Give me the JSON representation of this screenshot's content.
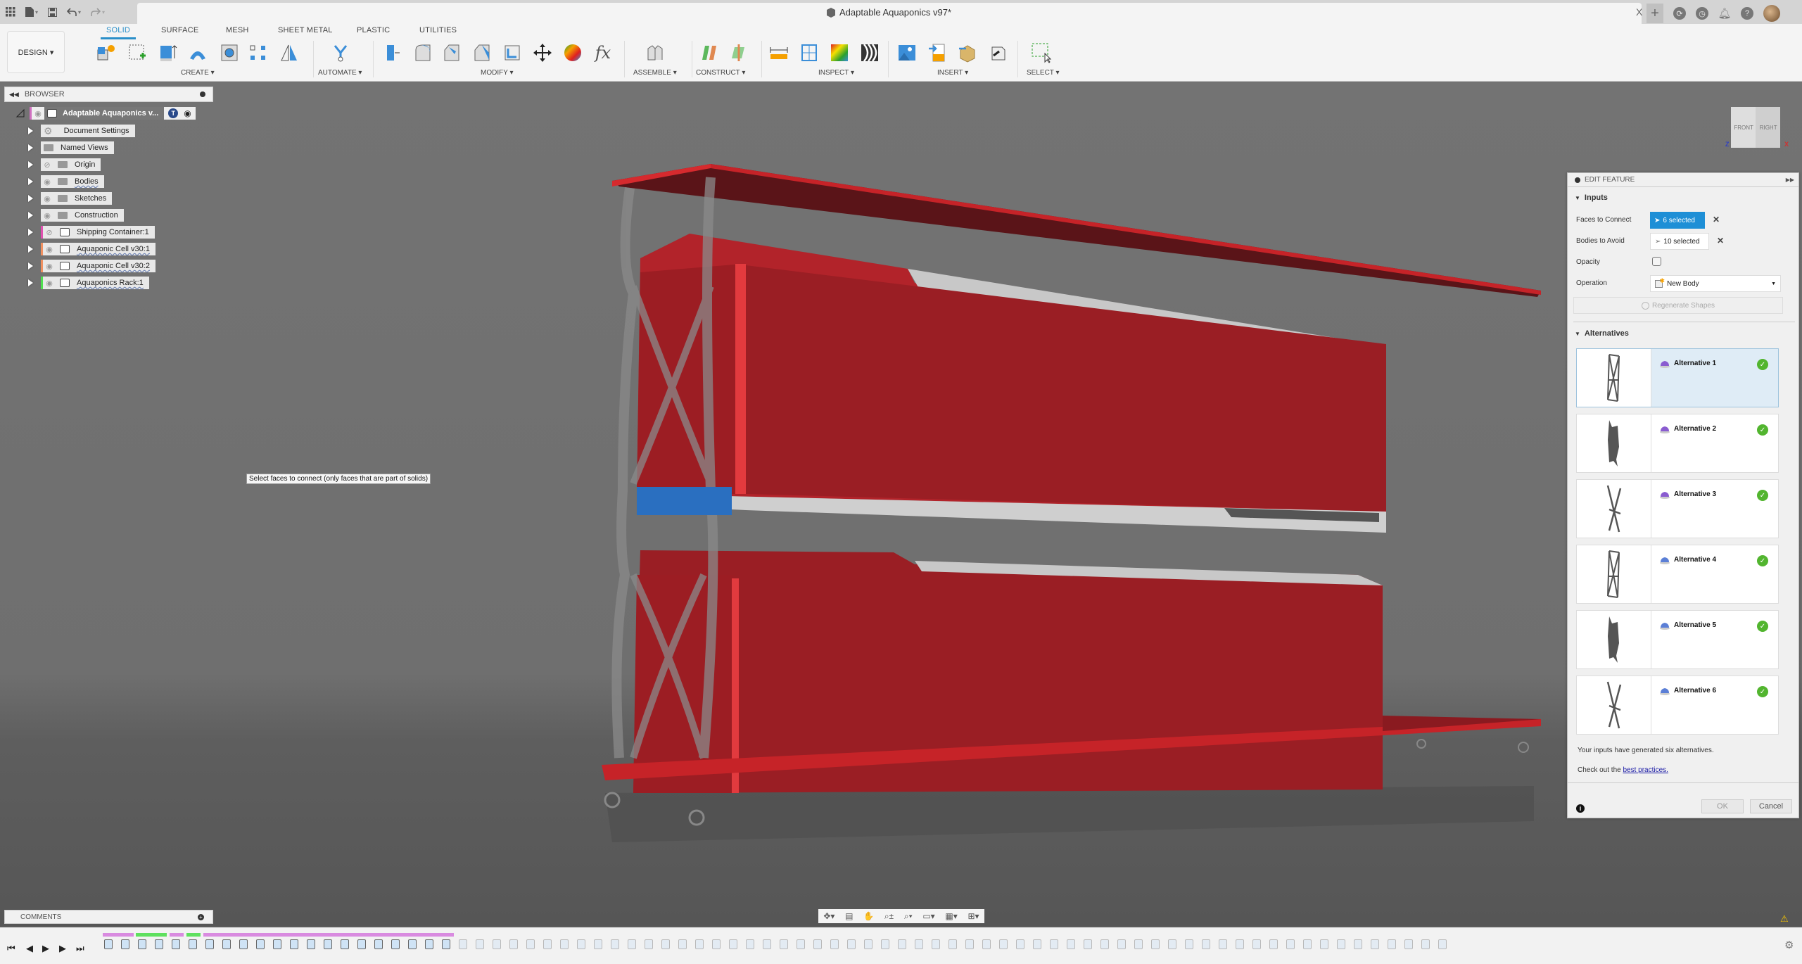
{
  "app": {
    "document_title": "Adaptable Aquaponics v97*",
    "quick_access": {
      "grid_icon": "apps-grid-icon",
      "file_icon": "file-icon",
      "save_icon": "save-icon",
      "undo_icon": "undo-icon",
      "redo_icon": "redo-icon"
    },
    "right_icons": [
      "new-tab-icon",
      "job-status-icon",
      "history-clock-icon",
      "notifications-bell-icon",
      "help-icon",
      "user-avatar"
    ],
    "close_label": "X",
    "plus_label": "+"
  },
  "ribbon": {
    "workspace": "DESIGN ▾",
    "tabs": [
      {
        "label": "SOLID",
        "active": true
      },
      {
        "label": "SURFACE",
        "active": false
      },
      {
        "label": "MESH",
        "active": false
      },
      {
        "label": "SHEET METAL",
        "active": false
      },
      {
        "label": "PLASTIC",
        "active": false
      },
      {
        "label": "UTILITIES",
        "active": false
      }
    ],
    "groups": [
      {
        "label": "CREATE ▾",
        "tools": [
          "new-component-icon",
          "create-sketch-icon",
          "extrude-icon",
          "revolve-icon",
          "hole-icon",
          "pattern-icon",
          "mirror-icon"
        ]
      },
      {
        "label": "AUTOMATE ▾",
        "tools": [
          "automate-icon"
        ]
      },
      {
        "label": "MODIFY ▾",
        "tools": [
          "press-pull-icon",
          "fillet-icon",
          "chamfer-icon",
          "shell-icon",
          "combine-icon",
          "move-icon",
          "appearance-icon",
          "parameters-fx-icon"
        ]
      },
      {
        "label": "ASSEMBLE ▾",
        "tools": [
          "joint-icon"
        ]
      },
      {
        "label": "CONSTRUCT ▾",
        "tools": [
          "offset-plane-icon",
          "midplane-icon"
        ]
      },
      {
        "label": "INSPECT ▾",
        "tools": [
          "measure-icon",
          "section-analysis-icon",
          "curvature-map-icon",
          "zebra-icon"
        ]
      },
      {
        "label": "INSERT ▾",
        "tools": [
          "decal-icon",
          "insert-svg-icon",
          "insert-mesh-icon",
          "insert-derive-icon"
        ]
      },
      {
        "label": "SELECT ▾",
        "tools": [
          "window-select-icon"
        ]
      }
    ]
  },
  "browser": {
    "title": "BROWSER",
    "root": {
      "label": "Adaptable Aquaponics v...",
      "badge": "T"
    },
    "items": [
      {
        "label": "Document Settings",
        "icon": "gear-icon",
        "visible": null,
        "tag": null,
        "wavy": false
      },
      {
        "label": "Named Views",
        "icon": "folder-icon",
        "visible": null,
        "tag": null,
        "wavy": false
      },
      {
        "label": "Origin",
        "icon": "folder-icon",
        "visible": false,
        "tag": null,
        "wavy": false
      },
      {
        "label": "Bodies",
        "icon": "folder-icon",
        "visible": true,
        "tag": null,
        "wavy": true
      },
      {
        "label": "Sketches",
        "icon": "folder-icon",
        "visible": true,
        "tag": null,
        "wavy": false
      },
      {
        "label": "Construction",
        "icon": "folder-icon",
        "visible": true,
        "tag": null,
        "wavy": false
      },
      {
        "label": "Shipping Container:1",
        "icon": "component-icon",
        "visible": false,
        "tag": "#e050b0",
        "wavy": false
      },
      {
        "label": "Aquaponic Cell v30:1",
        "icon": "component-icon",
        "visible": true,
        "tag": "#f09060",
        "wavy": true
      },
      {
        "label": "Aquaponic Cell v30:2",
        "icon": "component-icon",
        "visible": true,
        "tag": "#f09060",
        "wavy": true
      },
      {
        "label": "Aquaponics Rack:1",
        "icon": "component-icon",
        "visible": true,
        "tag": "#50e050",
        "wavy": true
      }
    ]
  },
  "viewport": {
    "tooltip": "Select faces to connect (only faces that are part of solids)",
    "viewcube": {
      "front": "FRONT",
      "right": "RIGHT",
      "axis_z": "Z",
      "axis_x": "X"
    }
  },
  "edit_feature": {
    "title": "EDIT FEATURE",
    "inputs_header": "Inputs",
    "faces_to_connect": {
      "label": "Faces to Connect",
      "value": "6 selected"
    },
    "bodies_to_avoid": {
      "label": "Bodies to Avoid",
      "value": "10 selected"
    },
    "opacity": {
      "label": "Opacity",
      "checked": false
    },
    "operation": {
      "label": "Operation",
      "value": "New Body"
    },
    "regenerate": "Regenerate Shapes",
    "alternatives_header": "Alternatives",
    "alternatives": [
      {
        "name": "Alternative 1",
        "selected": true,
        "status": "ok",
        "shape": "lattice",
        "icon_color": "#8a5cd0"
      },
      {
        "name": "Alternative 2",
        "selected": false,
        "status": "ok",
        "shape": "solid",
        "icon_color": "#8a5cd0"
      },
      {
        "name": "Alternative 3",
        "selected": false,
        "status": "ok",
        "shape": "cross",
        "icon_color": "#8a5cd0"
      },
      {
        "name": "Alternative 4",
        "selected": false,
        "status": "ok",
        "shape": "lattice",
        "icon_color": "#5b7fd6"
      },
      {
        "name": "Alternative 5",
        "selected": false,
        "status": "ok",
        "shape": "solid",
        "icon_color": "#5b7fd6"
      },
      {
        "name": "Alternative 6",
        "selected": false,
        "status": "ok",
        "shape": "cross",
        "icon_color": "#5b7fd6"
      }
    ],
    "summary": "Your inputs have generated six alternatives.",
    "link_prefix": "Check out the ",
    "link_text": "best practices.",
    "ok": "OK",
    "cancel": "Cancel"
  },
  "bottom": {
    "comments_title": "COMMENTS",
    "nav_tools": [
      "orbit-icon",
      "look-at-icon",
      "pan-hand-icon",
      "zoom-icon",
      "fit-zoom-icon",
      "display-settings-icon",
      "grid-settings-icon",
      "viewports-icon"
    ],
    "timeline_controls": [
      "skip-start-icon",
      "step-back-icon",
      "play-icon",
      "step-forward-icon",
      "skip-end-icon"
    ]
  },
  "colors": {
    "accent": "#2a8fc9",
    "selected_input": "#1e8fd6",
    "model_red": "#9a1e24",
    "model_red_bright": "#d6262b",
    "success_green": "#52b52f",
    "link": "#1a1aa6"
  }
}
